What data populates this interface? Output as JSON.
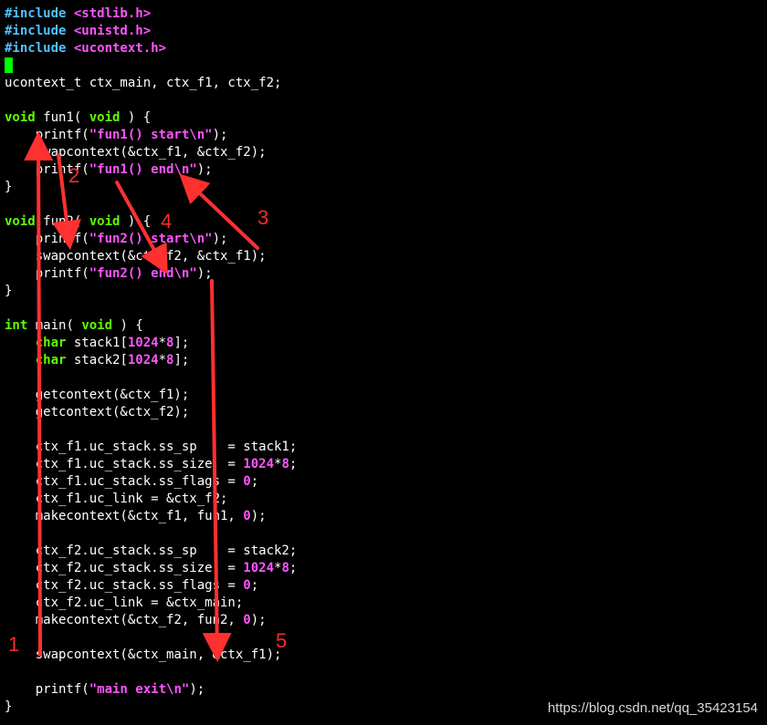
{
  "editor": {
    "cursor_color": "#00ff00",
    "lines": [
      [
        {
          "t": "#include ",
          "c": "pp"
        },
        {
          "t": "<stdlib.h>",
          "c": "inc"
        }
      ],
      [
        {
          "t": "#include ",
          "c": "pp"
        },
        {
          "t": "<unistd.h>",
          "c": "inc"
        }
      ],
      [
        {
          "t": "#include ",
          "c": "pp"
        },
        {
          "t": "<ucontext.h>",
          "c": "inc"
        }
      ],
      [
        {
          "cursor": true
        }
      ],
      [
        {
          "t": "ucontext_t ctx_main, ctx_f1, ctx_f2;",
          "c": "plain"
        }
      ],
      [],
      [
        {
          "t": "void",
          "c": "kw"
        },
        {
          "t": " fun1( ",
          "c": "plain"
        },
        {
          "t": "void",
          "c": "kw"
        },
        {
          "t": " ) {",
          "c": "plain"
        }
      ],
      [
        {
          "t": "    printf(",
          "c": "plain"
        },
        {
          "t": "\"fun1() start",
          "c": "str"
        },
        {
          "t": "\\n",
          "c": "esc"
        },
        {
          "t": "\"",
          "c": "str"
        },
        {
          "t": ");",
          "c": "plain"
        }
      ],
      [
        {
          "t": "    swapcontext(&ctx_f1, &ctx_f2);",
          "c": "plain"
        }
      ],
      [
        {
          "t": "    printf(",
          "c": "plain"
        },
        {
          "t": "\"fun1() end",
          "c": "str"
        },
        {
          "t": "\\n",
          "c": "esc"
        },
        {
          "t": "\"",
          "c": "str"
        },
        {
          "t": ");",
          "c": "plain"
        }
      ],
      [
        {
          "t": "}",
          "c": "plain"
        }
      ],
      [],
      [
        {
          "t": "void",
          "c": "kw"
        },
        {
          "t": " fun2( ",
          "c": "plain"
        },
        {
          "t": "void",
          "c": "kw"
        },
        {
          "t": " ) {",
          "c": "plain"
        }
      ],
      [
        {
          "t": "    printf(",
          "c": "plain"
        },
        {
          "t": "\"fun2() start",
          "c": "str"
        },
        {
          "t": "\\n",
          "c": "esc"
        },
        {
          "t": "\"",
          "c": "str"
        },
        {
          "t": ");",
          "c": "plain"
        }
      ],
      [
        {
          "t": "    swapcontext(&ctx_f2, &ctx_f1);",
          "c": "plain"
        }
      ],
      [
        {
          "t": "    printf(",
          "c": "plain"
        },
        {
          "t": "\"fun2() end",
          "c": "str"
        },
        {
          "t": "\\n",
          "c": "esc"
        },
        {
          "t": "\"",
          "c": "str"
        },
        {
          "t": ");",
          "c": "plain"
        }
      ],
      [
        {
          "t": "}",
          "c": "plain"
        }
      ],
      [],
      [
        {
          "t": "int",
          "c": "kw"
        },
        {
          "t": " main( ",
          "c": "plain"
        },
        {
          "t": "void",
          "c": "kw"
        },
        {
          "t": " ) {",
          "c": "plain"
        }
      ],
      [
        {
          "t": "    ",
          "c": "plain"
        },
        {
          "t": "char",
          "c": "kw"
        },
        {
          "t": " stack1[",
          "c": "plain"
        },
        {
          "t": "1024",
          "c": "num"
        },
        {
          "t": "*",
          "c": "plain"
        },
        {
          "t": "8",
          "c": "num"
        },
        {
          "t": "];",
          "c": "plain"
        }
      ],
      [
        {
          "t": "    ",
          "c": "plain"
        },
        {
          "t": "char",
          "c": "kw"
        },
        {
          "t": " stack2[",
          "c": "plain"
        },
        {
          "t": "1024",
          "c": "num"
        },
        {
          "t": "*",
          "c": "plain"
        },
        {
          "t": "8",
          "c": "num"
        },
        {
          "t": "];",
          "c": "plain"
        }
      ],
      [],
      [
        {
          "t": "    getcontext(&ctx_f1);",
          "c": "plain"
        }
      ],
      [
        {
          "t": "    getcontext(&ctx_f2);",
          "c": "plain"
        }
      ],
      [],
      [
        {
          "t": "    ctx_f1.uc_stack.ss_sp    = stack1;",
          "c": "plain"
        }
      ],
      [
        {
          "t": "    ctx_f1.uc_stack.ss_size  = ",
          "c": "plain"
        },
        {
          "t": "1024",
          "c": "num"
        },
        {
          "t": "*",
          "c": "plain"
        },
        {
          "t": "8",
          "c": "num"
        },
        {
          "t": ";",
          "c": "plain"
        }
      ],
      [
        {
          "t": "    ctx_f1.uc_stack.ss_flags = ",
          "c": "plain"
        },
        {
          "t": "0",
          "c": "num"
        },
        {
          "t": ";",
          "c": "plain"
        }
      ],
      [
        {
          "t": "    ctx_f1.uc_link = &ctx_f2;",
          "c": "plain"
        }
      ],
      [
        {
          "t": "    makecontext(&ctx_f1, fun1, ",
          "c": "plain"
        },
        {
          "t": "0",
          "c": "num"
        },
        {
          "t": ");",
          "c": "plain"
        }
      ],
      [],
      [
        {
          "t": "    ctx_f2.uc_stack.ss_sp    = stack2;",
          "c": "plain"
        }
      ],
      [
        {
          "t": "    ctx_f2.uc_stack.ss_size  = ",
          "c": "plain"
        },
        {
          "t": "1024",
          "c": "num"
        },
        {
          "t": "*",
          "c": "plain"
        },
        {
          "t": "8",
          "c": "num"
        },
        {
          "t": ";",
          "c": "plain"
        }
      ],
      [
        {
          "t": "    ctx_f2.uc_stack.ss_flags = ",
          "c": "plain"
        },
        {
          "t": "0",
          "c": "num"
        },
        {
          "t": ";",
          "c": "plain"
        }
      ],
      [
        {
          "t": "    ctx_f2.uc_link = &ctx_main;",
          "c": "plain"
        }
      ],
      [
        {
          "t": "    makecontext(&ctx_f2, fun2, ",
          "c": "plain"
        },
        {
          "t": "0",
          "c": "num"
        },
        {
          "t": ");",
          "c": "plain"
        }
      ],
      [],
      [
        {
          "t": "    swapcontext(&ctx_main, &ctx_f1);",
          "c": "plain"
        }
      ],
      [],
      [
        {
          "t": "    printf(",
          "c": "plain"
        },
        {
          "t": "\"main exit",
          "c": "str"
        },
        {
          "t": "\\n",
          "c": "esc"
        },
        {
          "t": "\"",
          "c": "str"
        },
        {
          "t": ");",
          "c": "plain"
        }
      ],
      [
        {
          "t": "}",
          "c": "plain"
        }
      ]
    ]
  },
  "annotations": {
    "arrow_color": "#ff3030",
    "step_labels": [
      "1",
      "2",
      "3",
      "4",
      "5"
    ]
  },
  "watermark": "https://blog.csdn.net/qq_35423154"
}
